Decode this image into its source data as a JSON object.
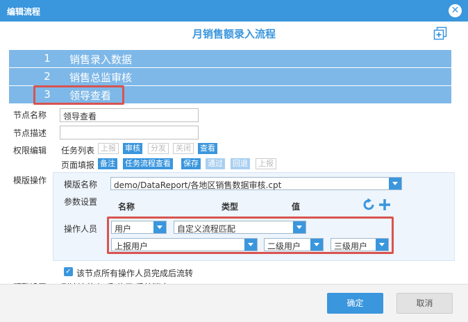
{
  "dialog": {
    "title": "编辑流程",
    "close_symbol": "✕"
  },
  "flow": {
    "title": "月销售额录入流程"
  },
  "steps": [
    {
      "num": "1",
      "name": "销售录入数据"
    },
    {
      "num": "2",
      "name": "销售总监审核"
    },
    {
      "num": "3",
      "name": "领导查看"
    }
  ],
  "node": {
    "name_label": "节点名称",
    "name_value": "领导查看",
    "desc_label": "节点描述",
    "desc_value": ""
  },
  "permissions": {
    "label": "权限编辑",
    "task_list_label": "任务列表",
    "task_list_tags": [
      "上报",
      "审核",
      "分发",
      "关闭",
      "查看"
    ],
    "page_fill_label": "页面填报",
    "page_fill_tags": [
      "备注",
      "任务流程查看",
      "保存",
      "通过",
      "回退",
      "上报"
    ]
  },
  "template": {
    "label": "模版操作",
    "name_label": "模版名称",
    "name_value": "demo/DataReport/各地区销售数据审核.cpt",
    "params_label": "参数设置",
    "col_name": "名称",
    "col_type": "类型",
    "col_value": "值",
    "operators_label": "操作人员",
    "op_type": "用户",
    "op_rule": "自定义流程匹配",
    "op_source": "上报用户",
    "op_level_from": "二级用户",
    "op_level_to": "三级用户"
  },
  "checkbox": {
    "label": "该节点所有操作人员完成后流转",
    "checked": true
  },
  "footer": {
    "ok": "确定",
    "cancel": "取消"
  },
  "partial": {
    "label": "预警设置",
    "text": "到达流节点 后 使用 系统消息"
  },
  "colors": {
    "accent": "#3a96dd",
    "step_bg": "#7eb8e8",
    "highlight": "#d9534f"
  }
}
